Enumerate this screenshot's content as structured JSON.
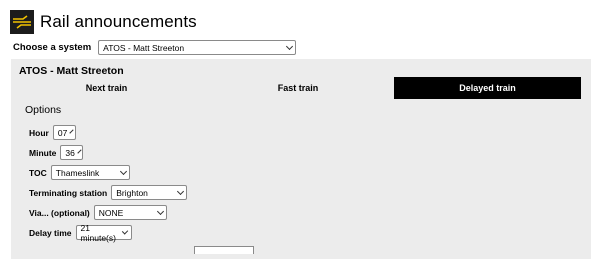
{
  "app": {
    "title": "Rail announcements",
    "logo_icon": "british-rail-double-arrow-icon",
    "logo_bg": "#1c1c1c",
    "logo_fg": "#f2c200"
  },
  "system": {
    "label": "Choose a system",
    "selected": "ATOS - Matt Streeton"
  },
  "panel": {
    "title": "ATOS - Matt Streeton",
    "tabs": [
      {
        "label": "Next train",
        "active": false
      },
      {
        "label": "Fast train",
        "active": false
      },
      {
        "label": "Delayed train",
        "active": true
      }
    ],
    "section_title": "Options",
    "fields": {
      "hour": {
        "label": "Hour",
        "value": "07"
      },
      "minute": {
        "label": "Minute",
        "value": "36"
      },
      "toc": {
        "label": "TOC",
        "value": "Thameslink"
      },
      "terminating": {
        "label": "Terminating station",
        "value": "Brighton"
      },
      "via": {
        "label": "Via... (optional)",
        "value": "NONE"
      },
      "delay": {
        "label": "Delay time",
        "value": "21 minute(s)"
      }
    }
  }
}
